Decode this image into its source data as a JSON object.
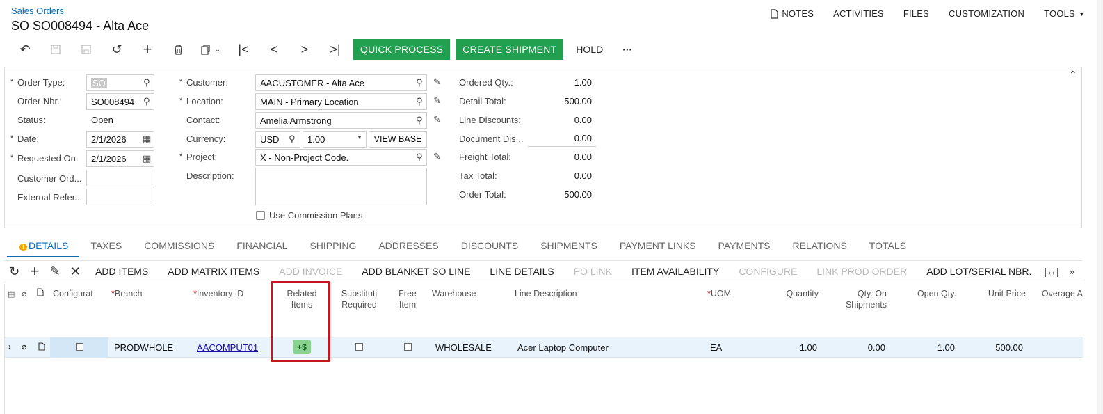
{
  "header": {
    "breadcrumb": "Sales Orders",
    "title": "SO SO008494 - Alta Ace",
    "nav": [
      "NOTES",
      "ACTIVITIES",
      "FILES",
      "CUSTOMIZATION",
      "TOOLS"
    ]
  },
  "toolbar": {
    "quick_process": "QUICK PROCESS",
    "create_shipment": "CREATE SHIPMENT",
    "hold": "HOLD",
    "more": "···"
  },
  "form": {
    "order_type_label": "Order Type:",
    "order_type": "SO",
    "order_nbr_label": "Order Nbr.:",
    "order_nbr": "SO008494",
    "status_label": "Status:",
    "status": "Open",
    "date_label": "Date:",
    "date": "2/1/2026",
    "requested_on_label": "Requested On:",
    "requested_on": "2/1/2026",
    "customer_ord_label": "Customer Ord...",
    "customer_ord": "",
    "external_ref_label": "External Refer...",
    "external_ref": "",
    "customer_label": "Customer:",
    "customer": "AACUSTOMER - Alta Ace",
    "location_label": "Location:",
    "location": "MAIN - Primary Location",
    "contact_label": "Contact:",
    "contact": "Amelia Armstrong",
    "currency_label": "Currency:",
    "currency": "USD",
    "currency_rate": "1.00",
    "view_base": "VIEW BASE",
    "project_label": "Project:",
    "project": "X - Non-Project Code.",
    "description_label": "Description:",
    "description": "",
    "use_commission": "Use Commission Plans",
    "ordered_qty_label": "Ordered Qty.:",
    "ordered_qty": "1.00",
    "detail_total_label": "Detail Total:",
    "detail_total": "500.00",
    "line_discounts_label": "Line Discounts:",
    "line_discounts": "0.00",
    "document_dis_label": "Document Dis...",
    "document_dis": "0.00",
    "freight_total_label": "Freight Total:",
    "freight_total": "0.00",
    "tax_total_label": "Tax Total:",
    "tax_total": "0.00",
    "order_total_label": "Order Total:",
    "order_total": "500.00"
  },
  "tabs": [
    "DETAILS",
    "TAXES",
    "COMMISSIONS",
    "FINANCIAL",
    "SHIPPING",
    "ADDRESSES",
    "DISCOUNTS",
    "SHIPMENTS",
    "PAYMENT LINKS",
    "PAYMENTS",
    "RELATIONS",
    "TOTALS"
  ],
  "grid_toolbar": {
    "add_items": "ADD ITEMS",
    "add_matrix_items": "ADD MATRIX ITEMS",
    "add_invoice": "ADD INVOICE",
    "add_blanket": "ADD BLANKET SO LINE",
    "line_details": "LINE DETAILS",
    "po_link": "PO LINK",
    "item_availability": "ITEM AVAILABILITY",
    "configure": "CONFIGURE",
    "link_prod_order": "LINK PROD ORDER",
    "add_lot_serial": "ADD LOT/SERIAL NBR."
  },
  "grid": {
    "headers": {
      "configurat": "Configurat",
      "branch": "Branch",
      "inventory_id": "Inventory ID",
      "related_items": "Related Items",
      "substitution": "Substituti Required",
      "free_item": "Free Item",
      "warehouse": "Warehouse",
      "line_description": "Line Description",
      "uom": "UOM",
      "quantity": "Quantity",
      "qty_on_shipments": "Qty. On Shipments",
      "open_qty": "Open Qty.",
      "unit_price": "Unit Price",
      "overage": "Overage A"
    },
    "row": {
      "branch": "PRODWHOLE",
      "inventory_id": "AACOMPUT01",
      "related": "+$",
      "warehouse": "WHOLESALE",
      "line_description": "Acer Laptop Computer",
      "uom": "EA",
      "quantity": "1.00",
      "qty_on_shipments": "0.00",
      "open_qty": "1.00",
      "unit_price": "500.00"
    }
  }
}
